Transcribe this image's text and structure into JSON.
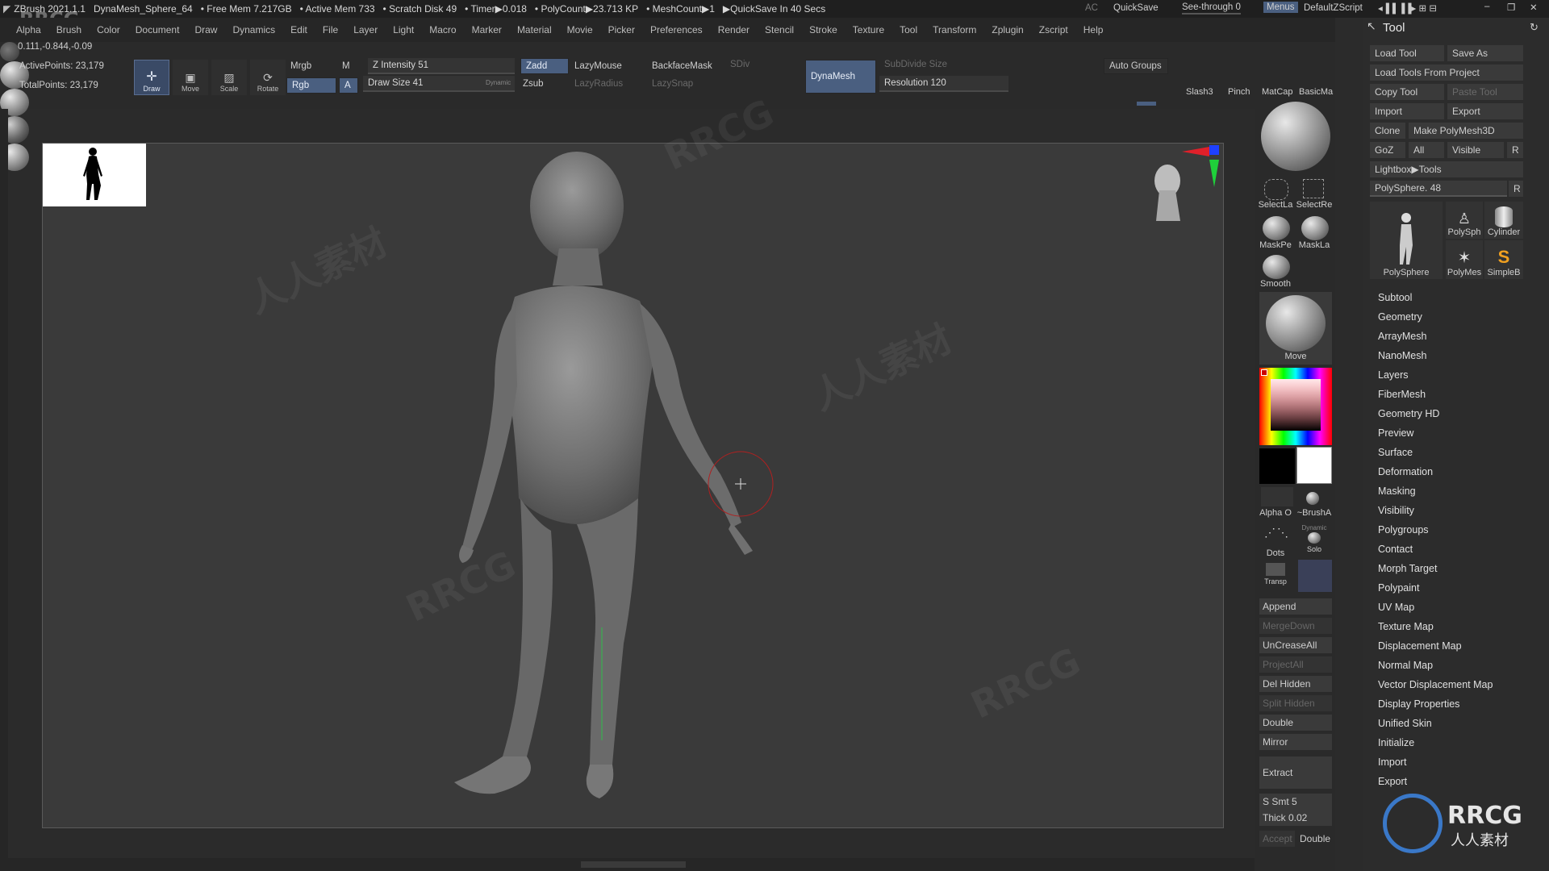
{
  "titlebar": {
    "app": "ZBrush 2021.1.1",
    "doc": "DynaMesh_Sphere_64",
    "free_mem": "• Free Mem 7.217GB",
    "active_mem": "• Active Mem 733",
    "scratch": "• Scratch Disk 49",
    "timer": "• Timer▶0.018",
    "polycount": "• PolyCount▶23.713 KP",
    "meshcount": "• MeshCount▶1",
    "quicksave_in": "▶QuickSave In 40 Secs",
    "ac": "AC",
    "quicksave": "QuickSave",
    "see_through": "See-through  0",
    "menus": "Menus",
    "script": "DefaultZScript"
  },
  "menu": [
    "Alpha",
    "Brush",
    "Color",
    "Document",
    "Draw",
    "Dynamics",
    "Edit",
    "File",
    "Layer",
    "Light",
    "Macro",
    "Marker",
    "Material",
    "Movie",
    "Picker",
    "Preferences",
    "Render",
    "Stencil",
    "Stroke",
    "Texture",
    "Tool",
    "Transform",
    "Zplugin",
    "Zscript",
    "Help"
  ],
  "stats": {
    "coords": "0.111,-0.844,-0.09",
    "active_points": "ActivePoints: 23,179",
    "total_points": "TotalPoints: 23,179"
  },
  "toolbar": {
    "draw": "Draw",
    "move": "Move",
    "scale": "Scale",
    "rotate": "Rotate",
    "mrgb": "Mrgb",
    "m": "M",
    "rgb": "Rgb",
    "a": "A",
    "z_intensity": "Z Intensity 51",
    "draw_size": "Draw Size 41",
    "dynamic": "Dynamic",
    "zadd": "Zadd",
    "zsub": "Zsub",
    "lazymouse": "LazyMouse",
    "lazyradius": "LazyRadius",
    "backfacemask": "BackfaceMask",
    "lazysnap": "LazySnap",
    "sdiv": "SDiv",
    "dynamesh": "DynaMesh",
    "subdivide_size": "SubDivide Size",
    "resolution": "Resolution 120",
    "auto_groups": "Auto Groups",
    "brushes": [
      "Slash3",
      "Pinch",
      "MatCap",
      "BasicMa"
    ]
  },
  "shelf": {
    "select_lasso": "SelectLa",
    "select_rect": "SelectRe",
    "mask_pen": "MaskPe",
    "mask_lasso": "MaskLa",
    "smooth": "Smooth",
    "move_brush": "Move",
    "alpha_off": "Alpha O",
    "brush_alpha": "~BrushA",
    "dots": "Dots",
    "dynamic": "Dynamic",
    "solo": "Solo",
    "transp": "Transp",
    "append": "Append",
    "mergedown": "MergeDown",
    "uncreaseall": "UnCreaseAll",
    "projectall": "ProjectAll",
    "del_hidden": "Del Hidden",
    "split_hidden": "Split Hidden",
    "double": "Double",
    "mirror": "Mirror",
    "extract": "Extract",
    "s_smt": "S Smt 5",
    "thick": "Thick 0.02",
    "accept": "Accept",
    "double2": "Double"
  },
  "tool_panel": {
    "title": "Tool",
    "load_tool": "Load Tool",
    "save_as": "Save As",
    "load_from_project": "Load Tools From Project",
    "copy_tool": "Copy Tool",
    "paste_tool": "Paste Tool",
    "import": "Import",
    "export": "Export",
    "clone": "Clone",
    "make_polymesh": "Make PolyMesh3D",
    "goz": "GoZ",
    "all": "All",
    "visible": "Visible",
    "r": "R",
    "lightbox": "Lightbox▶Tools",
    "polysphere_slider": "PolySphere. 48",
    "r2": "R",
    "thumbs": [
      "PolySphere",
      "PolySph",
      "Cylinder",
      "PolyMes",
      "SimpleB"
    ],
    "sections": [
      "Subtool",
      "Geometry",
      "ArrayMesh",
      "NanoMesh",
      "Layers",
      "FiberMesh",
      "Geometry HD",
      "Preview",
      "Surface",
      "Deformation",
      "Masking",
      "Visibility",
      "Polygroups",
      "Contact",
      "Morph Target",
      "Polypaint",
      "UV Map",
      "Texture Map",
      "Displacement Map",
      "Normal Map",
      "Vector Displacement Map",
      "Display Properties",
      "Unified Skin",
      "Initialize",
      "Import",
      "Export"
    ]
  },
  "branding": {
    "logo_top": "RRCG",
    "logo_bottom": "RRCG",
    "logo_sub": "人人素材",
    "watermark_a": "RRCG",
    "watermark_b": "人人素材"
  }
}
